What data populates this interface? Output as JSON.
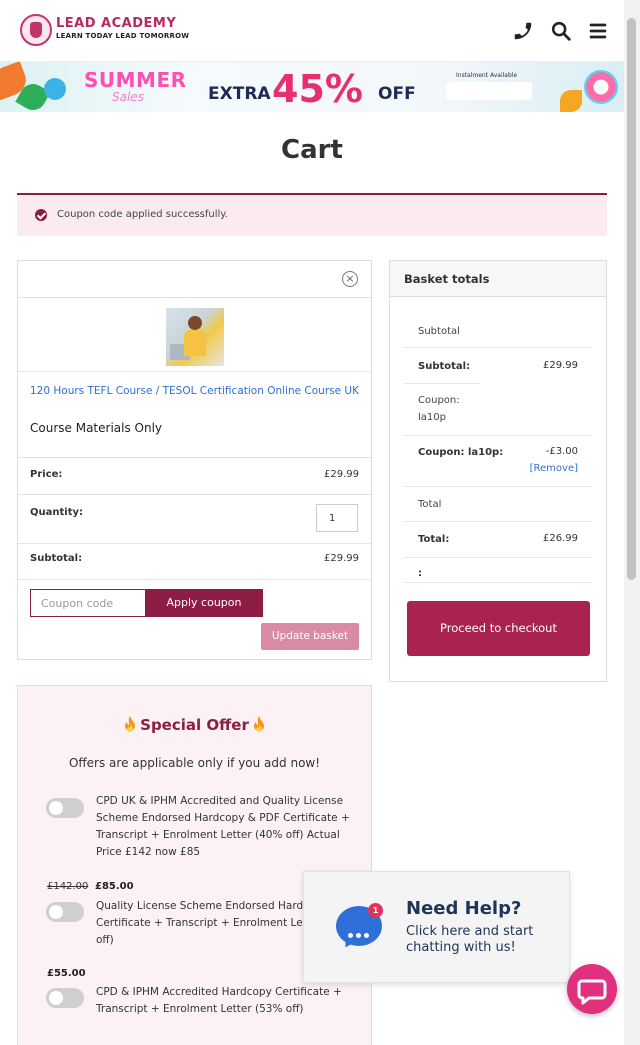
{
  "header": {
    "brand": "LEAD ACADEMY",
    "tagline": "LEARN TODAY LEAD TOMORROW"
  },
  "banner": {
    "title": "SUMMER",
    "subtitle": "Sales",
    "extra": "EXTRA",
    "discount": "45%",
    "off": "OFF",
    "installment": "Instalment Available"
  },
  "page": {
    "title": "Cart"
  },
  "notice": {
    "message": "Coupon code applied successfully."
  },
  "cart": {
    "product_name": "120 Hours TEFL Course / TESOL Certification Online Course UK",
    "variant": "Course Materials Only",
    "price_label": "Price:",
    "price_value": "£29.99",
    "quantity_label": "Quantity:",
    "quantity_value": "1",
    "subtotal_label": "Subtotal:",
    "subtotal_value": "£29.99",
    "coupon_placeholder": "Coupon code",
    "apply_coupon": "Apply coupon",
    "update_basket": "Update basket",
    "remove_symbol": "×"
  },
  "totals": {
    "heading": "Basket totals",
    "subtotal_heading": "Subtotal",
    "subtotal_label": "Subtotal:",
    "subtotal_value": "£29.99",
    "coupon_heading": "Coupon: la10p",
    "coupon_label": "Coupon: la10p:",
    "coupon_value": "-£3.00",
    "coupon_remove": "[Remove]",
    "total_heading": "Total",
    "total_label": "Total:",
    "total_value": "£26.99",
    "empty_label": ":",
    "checkout": "Proceed to checkout"
  },
  "offer": {
    "title": "Special Offer",
    "subtitle": "Offers are applicable only if you add now!",
    "items": [
      {
        "text": "CPD UK & IPHM Accredited and Quality License Scheme Endorsed Hardcopy & PDF Certificate + Transcript + Enrolment Letter (40% off) Actual Price £142 now £85"
      },
      {
        "old_price": "£142.00",
        "new_price": "£85.00",
        "text": "Quality License Scheme Endorsed Hardcopy Certificate + Transcript + Enrolment Letter (40% off)"
      },
      {
        "new_price": "£55.00",
        "text": "CPD & IPHM Accredited Hardcopy Certificate + Transcript + Enrolment Letter (53% off)"
      }
    ]
  },
  "help": {
    "title": "Need Help?",
    "subtitle": "Click here and start chatting with us!",
    "badge": "1"
  },
  "colors": {
    "brand": "#8c1d44",
    "checkout": "#a8244f",
    "link": "#2f6fcf",
    "chat": "#e0307e"
  }
}
